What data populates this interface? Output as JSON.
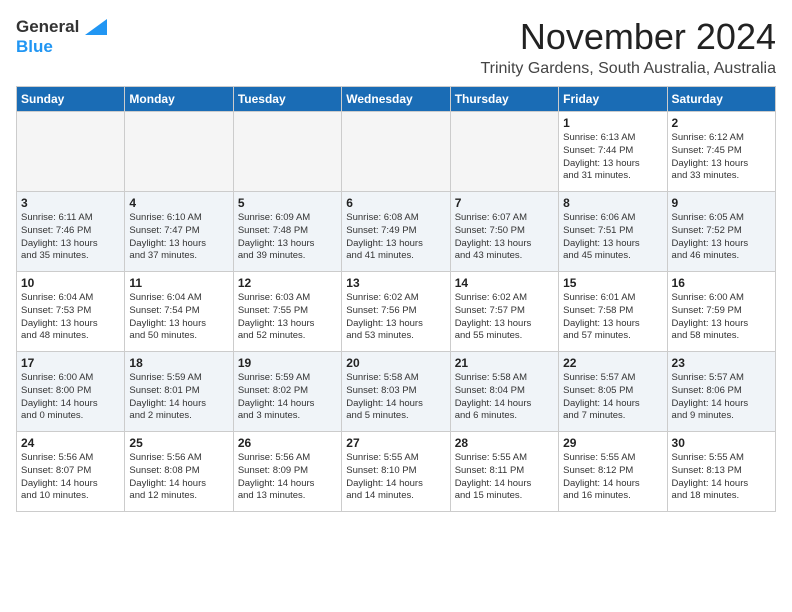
{
  "header": {
    "logo_general": "General",
    "logo_blue": "Blue",
    "month_title": "November 2024",
    "location": "Trinity Gardens, South Australia, Australia"
  },
  "calendar": {
    "weekdays": [
      "Sunday",
      "Monday",
      "Tuesday",
      "Wednesday",
      "Thursday",
      "Friday",
      "Saturday"
    ],
    "weeks": [
      [
        {
          "day": "",
          "info": ""
        },
        {
          "day": "",
          "info": ""
        },
        {
          "day": "",
          "info": ""
        },
        {
          "day": "",
          "info": ""
        },
        {
          "day": "",
          "info": ""
        },
        {
          "day": "1",
          "info": "Sunrise: 6:13 AM\nSunset: 7:44 PM\nDaylight: 13 hours\nand 31 minutes."
        },
        {
          "day": "2",
          "info": "Sunrise: 6:12 AM\nSunset: 7:45 PM\nDaylight: 13 hours\nand 33 minutes."
        }
      ],
      [
        {
          "day": "3",
          "info": "Sunrise: 6:11 AM\nSunset: 7:46 PM\nDaylight: 13 hours\nand 35 minutes."
        },
        {
          "day": "4",
          "info": "Sunrise: 6:10 AM\nSunset: 7:47 PM\nDaylight: 13 hours\nand 37 minutes."
        },
        {
          "day": "5",
          "info": "Sunrise: 6:09 AM\nSunset: 7:48 PM\nDaylight: 13 hours\nand 39 minutes."
        },
        {
          "day": "6",
          "info": "Sunrise: 6:08 AM\nSunset: 7:49 PM\nDaylight: 13 hours\nand 41 minutes."
        },
        {
          "day": "7",
          "info": "Sunrise: 6:07 AM\nSunset: 7:50 PM\nDaylight: 13 hours\nand 43 minutes."
        },
        {
          "day": "8",
          "info": "Sunrise: 6:06 AM\nSunset: 7:51 PM\nDaylight: 13 hours\nand 45 minutes."
        },
        {
          "day": "9",
          "info": "Sunrise: 6:05 AM\nSunset: 7:52 PM\nDaylight: 13 hours\nand 46 minutes."
        }
      ],
      [
        {
          "day": "10",
          "info": "Sunrise: 6:04 AM\nSunset: 7:53 PM\nDaylight: 13 hours\nand 48 minutes."
        },
        {
          "day": "11",
          "info": "Sunrise: 6:04 AM\nSunset: 7:54 PM\nDaylight: 13 hours\nand 50 minutes."
        },
        {
          "day": "12",
          "info": "Sunrise: 6:03 AM\nSunset: 7:55 PM\nDaylight: 13 hours\nand 52 minutes."
        },
        {
          "day": "13",
          "info": "Sunrise: 6:02 AM\nSunset: 7:56 PM\nDaylight: 13 hours\nand 53 minutes."
        },
        {
          "day": "14",
          "info": "Sunrise: 6:02 AM\nSunset: 7:57 PM\nDaylight: 13 hours\nand 55 minutes."
        },
        {
          "day": "15",
          "info": "Sunrise: 6:01 AM\nSunset: 7:58 PM\nDaylight: 13 hours\nand 57 minutes."
        },
        {
          "day": "16",
          "info": "Sunrise: 6:00 AM\nSunset: 7:59 PM\nDaylight: 13 hours\nand 58 minutes."
        }
      ],
      [
        {
          "day": "17",
          "info": "Sunrise: 6:00 AM\nSunset: 8:00 PM\nDaylight: 14 hours\nand 0 minutes."
        },
        {
          "day": "18",
          "info": "Sunrise: 5:59 AM\nSunset: 8:01 PM\nDaylight: 14 hours\nand 2 minutes."
        },
        {
          "day": "19",
          "info": "Sunrise: 5:59 AM\nSunset: 8:02 PM\nDaylight: 14 hours\nand 3 minutes."
        },
        {
          "day": "20",
          "info": "Sunrise: 5:58 AM\nSunset: 8:03 PM\nDaylight: 14 hours\nand 5 minutes."
        },
        {
          "day": "21",
          "info": "Sunrise: 5:58 AM\nSunset: 8:04 PM\nDaylight: 14 hours\nand 6 minutes."
        },
        {
          "day": "22",
          "info": "Sunrise: 5:57 AM\nSunset: 8:05 PM\nDaylight: 14 hours\nand 7 minutes."
        },
        {
          "day": "23",
          "info": "Sunrise: 5:57 AM\nSunset: 8:06 PM\nDaylight: 14 hours\nand 9 minutes."
        }
      ],
      [
        {
          "day": "24",
          "info": "Sunrise: 5:56 AM\nSunset: 8:07 PM\nDaylight: 14 hours\nand 10 minutes."
        },
        {
          "day": "25",
          "info": "Sunrise: 5:56 AM\nSunset: 8:08 PM\nDaylight: 14 hours\nand 12 minutes."
        },
        {
          "day": "26",
          "info": "Sunrise: 5:56 AM\nSunset: 8:09 PM\nDaylight: 14 hours\nand 13 minutes."
        },
        {
          "day": "27",
          "info": "Sunrise: 5:55 AM\nSunset: 8:10 PM\nDaylight: 14 hours\nand 14 minutes."
        },
        {
          "day": "28",
          "info": "Sunrise: 5:55 AM\nSunset: 8:11 PM\nDaylight: 14 hours\nand 15 minutes."
        },
        {
          "day": "29",
          "info": "Sunrise: 5:55 AM\nSunset: 8:12 PM\nDaylight: 14 hours\nand 16 minutes."
        },
        {
          "day": "30",
          "info": "Sunrise: 5:55 AM\nSunset: 8:13 PM\nDaylight: 14 hours\nand 18 minutes."
        }
      ]
    ]
  }
}
